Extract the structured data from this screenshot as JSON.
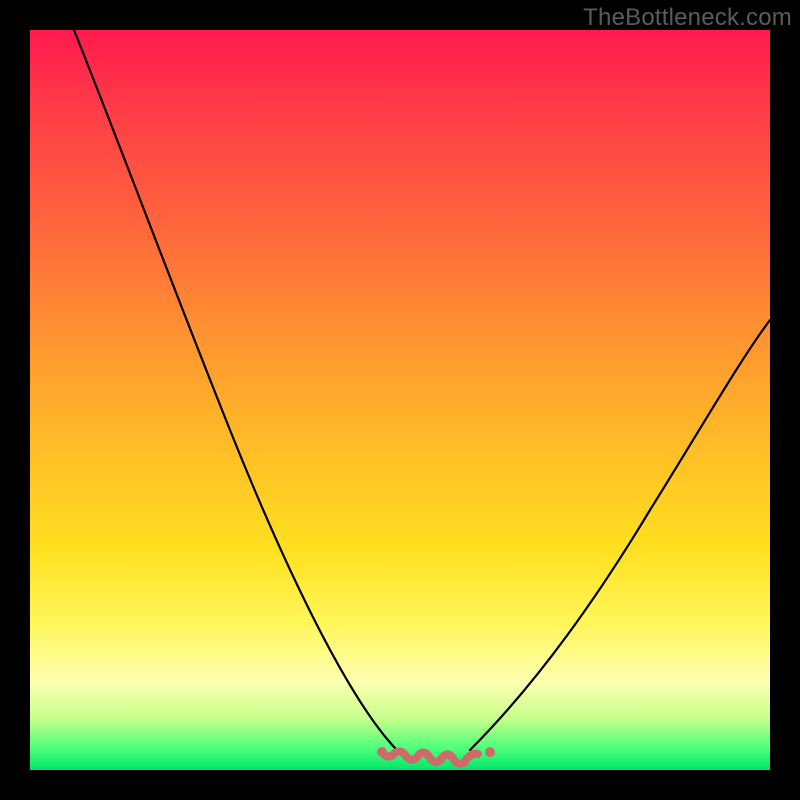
{
  "watermark": "TheBottleneck.com",
  "chart_data": {
    "type": "line",
    "title": "",
    "xlabel": "",
    "ylabel": "",
    "xlim": [
      0,
      100
    ],
    "ylim": [
      0,
      100
    ],
    "grid": false,
    "legend": false,
    "background_gradient": [
      "#ff1a4d",
      "#ff9530",
      "#ffe01f",
      "#feffb0",
      "#00e66a"
    ],
    "series": [
      {
        "name": "left-branch",
        "color": "#000000",
        "x": [
          6,
          12,
          18,
          24,
          30,
          36,
          42,
          47,
          50,
          52
        ],
        "y": [
          100,
          84,
          70,
          56,
          42,
          30,
          18,
          8,
          3,
          1
        ]
      },
      {
        "name": "valley-floor",
        "color": "#d46a6a",
        "x": [
          47,
          50,
          54,
          58,
          62
        ],
        "y": [
          2.2,
          1.4,
          1.2,
          1.4,
          2.2
        ]
      },
      {
        "name": "right-branch",
        "color": "#000000",
        "x": [
          58,
          62,
          68,
          74,
          80,
          86,
          92,
          98,
          100
        ],
        "y": [
          1,
          3,
          9,
          17,
          26,
          36,
          46,
          56,
          60
        ]
      }
    ],
    "annotations": []
  }
}
